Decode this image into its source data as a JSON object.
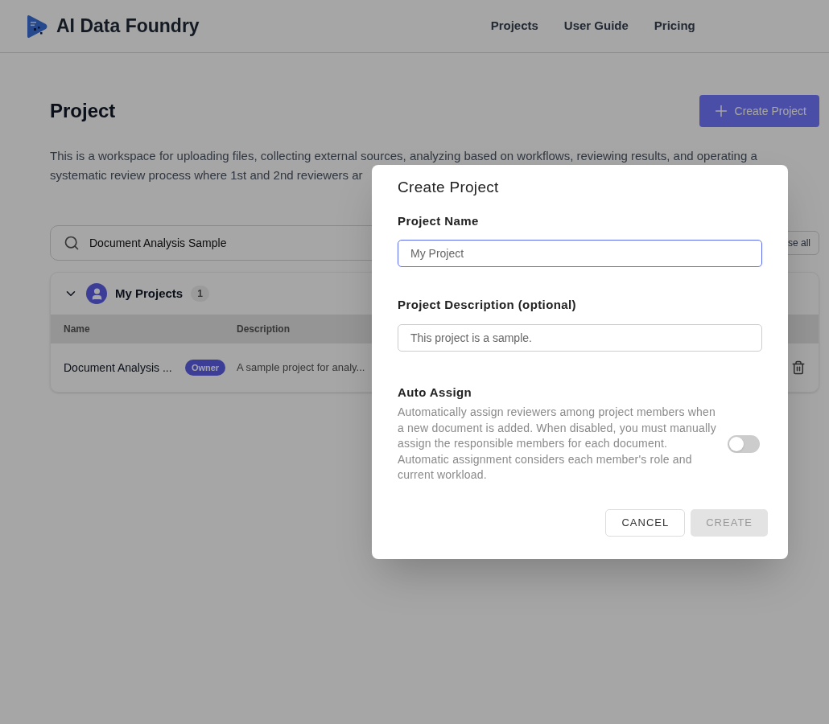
{
  "app": {
    "name": "AI Data Foundry"
  },
  "nav": [
    {
      "label": "Projects"
    },
    {
      "label": "User Guide"
    },
    {
      "label": "Pricing"
    }
  ],
  "page": {
    "title": "Project",
    "create_button": "Create Project",
    "description_lines": [
      "This is a workspace for uploading files, collecting external sources, analyzing based on workflows, reviewing results, and operating a",
      "systematic review process where 1st and 2nd reviewers ar"
    ],
    "search": {
      "value": "Document Analysis Sample"
    },
    "collapse_button": "se all",
    "group": {
      "title": "My Projects",
      "count": "1",
      "expanded": true
    },
    "table": {
      "columns": [
        "Name",
        "Description"
      ],
      "rows": [
        {
          "name": "Document Analysis ...",
          "role": "Owner",
          "description": "A sample project for analy..."
        }
      ]
    }
  },
  "dialog": {
    "title": "Create Project",
    "fields": [
      {
        "label": "Project Name",
        "placeholder": "My Project",
        "focused": true
      },
      {
        "label": "Project Description (optional)",
        "placeholder": "This project is a sample.",
        "focused": false
      }
    ],
    "auto_assign": {
      "label": "Auto Assign",
      "description": "Automatically assign reviewers among project members when a new document is added. When disabled, you must manually assign the responsible members for each document. Automatic assignment considers each member's role and current workload.",
      "on": false
    },
    "buttons": [
      {
        "label": "CANCEL",
        "kind": "outline",
        "disabled": false
      },
      {
        "label": "CREATE",
        "kind": "primary",
        "disabled": true
      }
    ]
  }
}
